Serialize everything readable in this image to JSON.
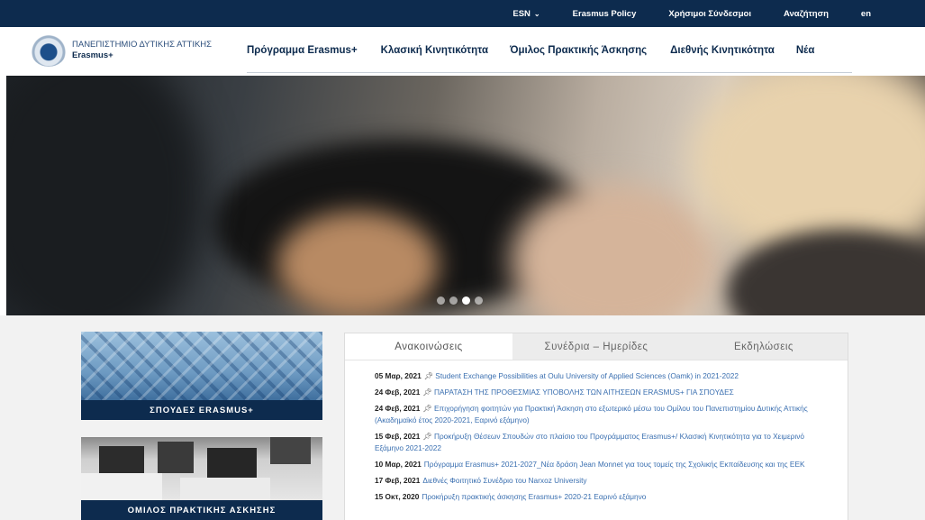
{
  "topbar": {
    "links": [
      {
        "label": "ESN",
        "chevron": "chevron-down-icon"
      },
      {
        "label": "Erasmus Policy"
      },
      {
        "label": "Χρήσιμοι Σύνδεσμοι"
      },
      {
        "label": "Αναζήτηση"
      },
      {
        "label": "en"
      }
    ]
  },
  "header": {
    "logo_title": "ΠΑΝΕΠΙΣΤΗΜΙΟ ΔΥΤΙΚΗΣ ΑΤΤΙΚΗΣ",
    "logo_subtitle": "Erasmus+",
    "nav": [
      "Πρόγραμμα Erasmus+",
      "Κλασική Κινητικότητα",
      "Όμιλος Πρακτικής Άσκησης",
      "Διεθνής Κινητικότητα",
      "Νέα"
    ]
  },
  "hero": {
    "slide_count": 4,
    "active_slide": 3
  },
  "cards": [
    {
      "label": "ΣΠΟΥΔΕΣ ERASMUS+"
    },
    {
      "label": "ΟΜΙΛΟΣ ΠΡΑΚΤΙΚΗΣ ΑΣΚΗΣΗΣ"
    }
  ],
  "news": {
    "tabs": [
      "Ανακοινώσεις",
      "Συνέδρια – Ημερίδες",
      "Εκδηλώσεις"
    ],
    "active_tab": 0,
    "items": [
      {
        "date": "05 Μαρ, 2021",
        "pin": true,
        "text": "Student Exchange Possibilities at Oulu University of Applied Sciences (Oamk) in 2021-2022"
      },
      {
        "date": "24 Φεβ, 2021",
        "pin": true,
        "text": "ΠΑΡΑΤΑΣΗ ΤΗΣ ΠΡΟΘΕΣΜΙΑΣ ΥΠΟΒΟΛΗΣ ΤΩΝ ΑΙΤΗΣΕΩΝ ERASMUS+ ΓΙΑ ΣΠΟΥΔΕΣ"
      },
      {
        "date": "24 Φεβ, 2021",
        "pin": true,
        "text": "Επιχορήγηση φοιτητών για Πρακτική Άσκηση στο εξωτερικό μέσω του Ομίλου του Πανεπιστημίου Δυτικής Αττικής (Ακαδημαϊκό έτος 2020-2021, Εαρινό εξάμηνο)"
      },
      {
        "date": "15 Φεβ, 2021",
        "pin": true,
        "text": "Προκήρυξη Θέσεων Σπουδών στο πλαίσιο του Προγράμματος Erasmus+/ Κλασική Κινητικότητα για το Χειμερινό Εξάμηνο 2021-2022"
      },
      {
        "date": "10 Μαρ, 2021",
        "pin": false,
        "text": "Πρόγραμμα Erasmus+ 2021-2027_Νέα δράση Jean Monnet για τους τομείς της Σχολικής Εκπαίδευσης και της ΕΕΚ"
      },
      {
        "date": "17 Φεβ, 2021",
        "pin": false,
        "text": "Διεθνές Φοιτητικό Συνέδριο του Narxoz University"
      },
      {
        "date": "15 Οκτ, 2020",
        "pin": false,
        "text": "Προκήρυξη πρακτικής άσκησης Erasmus+ 2020-21 Εαρινό εξάμηνο"
      }
    ]
  }
}
